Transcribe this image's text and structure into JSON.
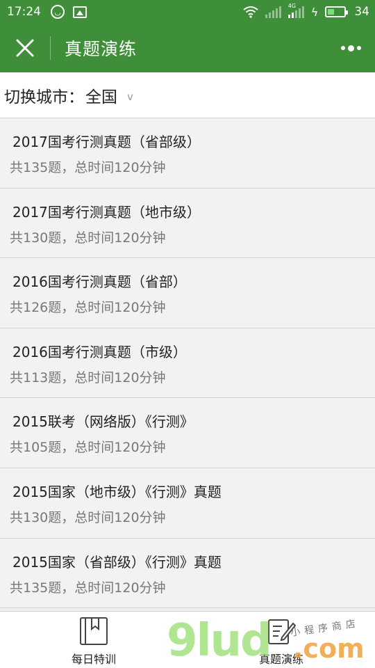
{
  "status_bar": {
    "time": "17:24",
    "battery": "34",
    "network_tag": "4G"
  },
  "header": {
    "title": "真题演练"
  },
  "city": {
    "label": "切换城市：",
    "value": "全国",
    "arrow": "v"
  },
  "items": [
    {
      "title": "2017国考行测真题（省部级）",
      "meta": "共135题，总时间120分钟"
    },
    {
      "title": "2017国考行测真题（地市级）",
      "meta": "共130题，总时间120分钟"
    },
    {
      "title": "2016国考行测真题（省部）",
      "meta": "共126题，总时间120分钟"
    },
    {
      "title": "2016国考行测真题（市级）",
      "meta": "共113题，总时间120分钟"
    },
    {
      "title": "2015联考（网络版）《行测》",
      "meta": "共105题，总时间120分钟"
    },
    {
      "title": "2015国家（地市级）《行测》真题",
      "meta": "共130题，总时间120分钟"
    },
    {
      "title": "2015国家（省部级）《行测》真题",
      "meta": "共135题，总时间120分钟"
    }
  ],
  "tabs": [
    {
      "label": "每日特训",
      "icon": "bookmark-book-icon"
    },
    {
      "label": "真题演练",
      "icon": "edit-document-icon"
    }
  ],
  "watermark": {
    "main": "9lud",
    "suffix": ".com",
    "small": "小程序商店"
  },
  "colors": {
    "brand_green": "#3f8f3a",
    "text_primary": "#222222",
    "text_secondary": "#777777"
  }
}
